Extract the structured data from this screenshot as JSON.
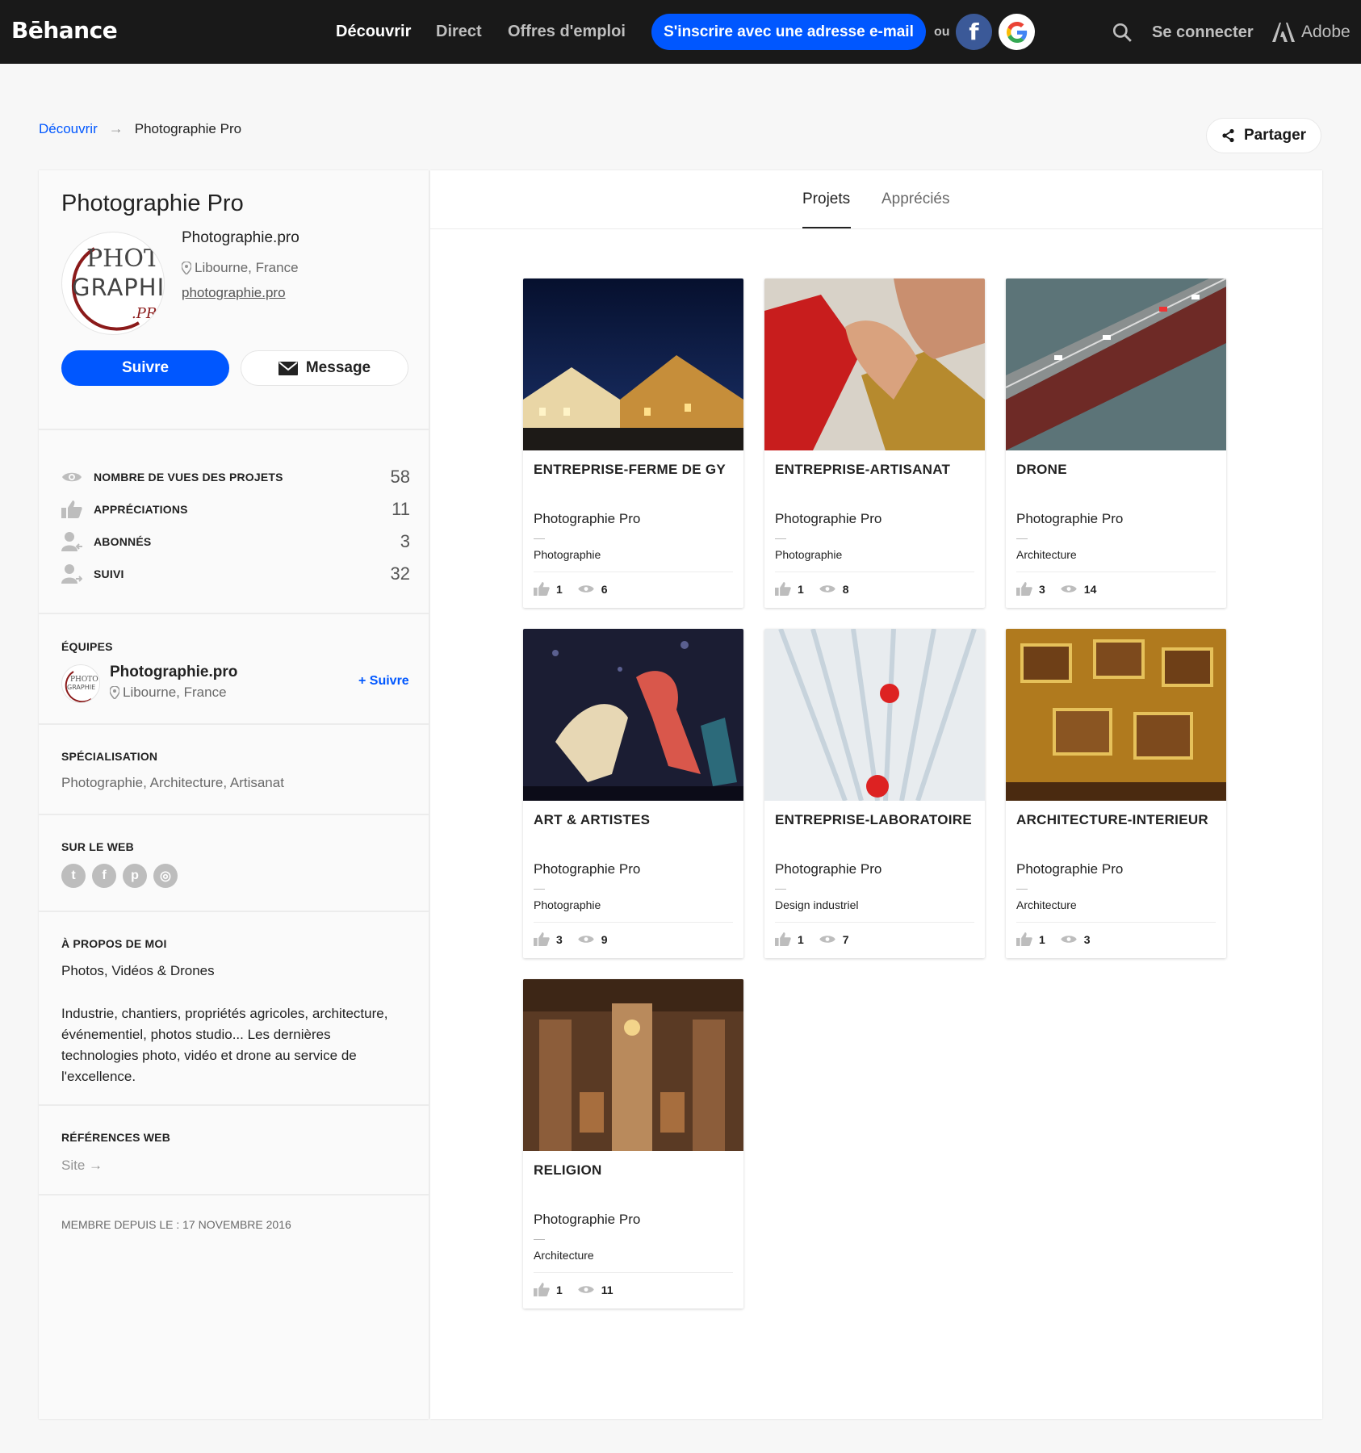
{
  "topbar": {
    "brand": "Bēhance",
    "nav": [
      "Découvrir",
      "Direct",
      "Offres d'emploi"
    ],
    "signup": "S'inscrire avec une adresse e-mail",
    "or": "ou",
    "login": "Se connecter",
    "adobe": "Adobe"
  },
  "breadcrumb": {
    "root": "Découvrir",
    "arrow": "→",
    "current": "Photographie Pro"
  },
  "share": "Partager",
  "profile": {
    "title": "Photographie Pro",
    "name": "Photographie.pro",
    "location": "Libourne, France",
    "url": "photographie.pro",
    "follow": "Suivre",
    "message": "Message"
  },
  "stats": [
    {
      "icon": "eye-icon",
      "label": "NOMBRE DE VUES DES PROJETS",
      "value": "58"
    },
    {
      "icon": "thumbs-up-icon",
      "label": "APPRÉCIATIONS",
      "value": "11"
    },
    {
      "icon": "followers-icon",
      "label": "ABONNÉS",
      "value": "3"
    },
    {
      "icon": "following-icon",
      "label": "SUIVI",
      "value": "32"
    }
  ],
  "teams": {
    "label": "ÉQUIPES",
    "name": "Photographie.pro",
    "location": "Libourne, France",
    "follow": "+ Suivre"
  },
  "specialization": {
    "label": "SPÉCIALISATION",
    "text": "Photographie, Architecture, Artisanat"
  },
  "web": {
    "label": "SUR LE WEB",
    "icons": [
      "twitter-icon",
      "facebook-icon",
      "pinterest-icon",
      "instagram-icon"
    ]
  },
  "about": {
    "label": "À PROPOS DE MOI",
    "line1": "Photos, Vidéos & Drones",
    "body": "Industrie, chantiers, propriétés agricoles, architecture, événementiel, photos studio... Les dernières technologies photo, vidéo et drone au service de l'excellence."
  },
  "references": {
    "label": "RÉFÉRENCES WEB",
    "link": "Site →"
  },
  "member": "MEMBRE DEPUIS LE : 17 NOVEMBRE 2016",
  "tabs": [
    "Projets",
    "Appréciés"
  ],
  "projects": [
    {
      "title": "ENTREPRISE-FERME DE GY",
      "owner": "Photographie Pro",
      "field": "Photographie",
      "likes": "1",
      "views": "6"
    },
    {
      "title": "ENTREPRISE-ARTISANAT",
      "owner": "Photographie Pro",
      "field": "Photographie",
      "likes": "1",
      "views": "8"
    },
    {
      "title": "DRONE",
      "owner": "Photographie Pro",
      "field": "Architecture",
      "likes": "3",
      "views": "14"
    },
    {
      "title": "ART & ARTISTES",
      "owner": "Photographie Pro",
      "field": "Photographie",
      "likes": "3",
      "views": "9"
    },
    {
      "title": "ENTREPRISE-LABORATOIRE",
      "owner": "Photographie Pro",
      "field": "Design industriel",
      "likes": "1",
      "views": "7"
    },
    {
      "title": "ARCHITECTURE-INTERIEUR",
      "owner": "Photographie Pro",
      "field": "Architecture",
      "likes": "1",
      "views": "3"
    },
    {
      "title": "RELIGION",
      "owner": "Photographie Pro",
      "field": "Architecture",
      "likes": "1",
      "views": "11"
    }
  ],
  "colors": {
    "accent": "#0057ff",
    "topbar": "#191919",
    "facebook": "#3b5998"
  }
}
